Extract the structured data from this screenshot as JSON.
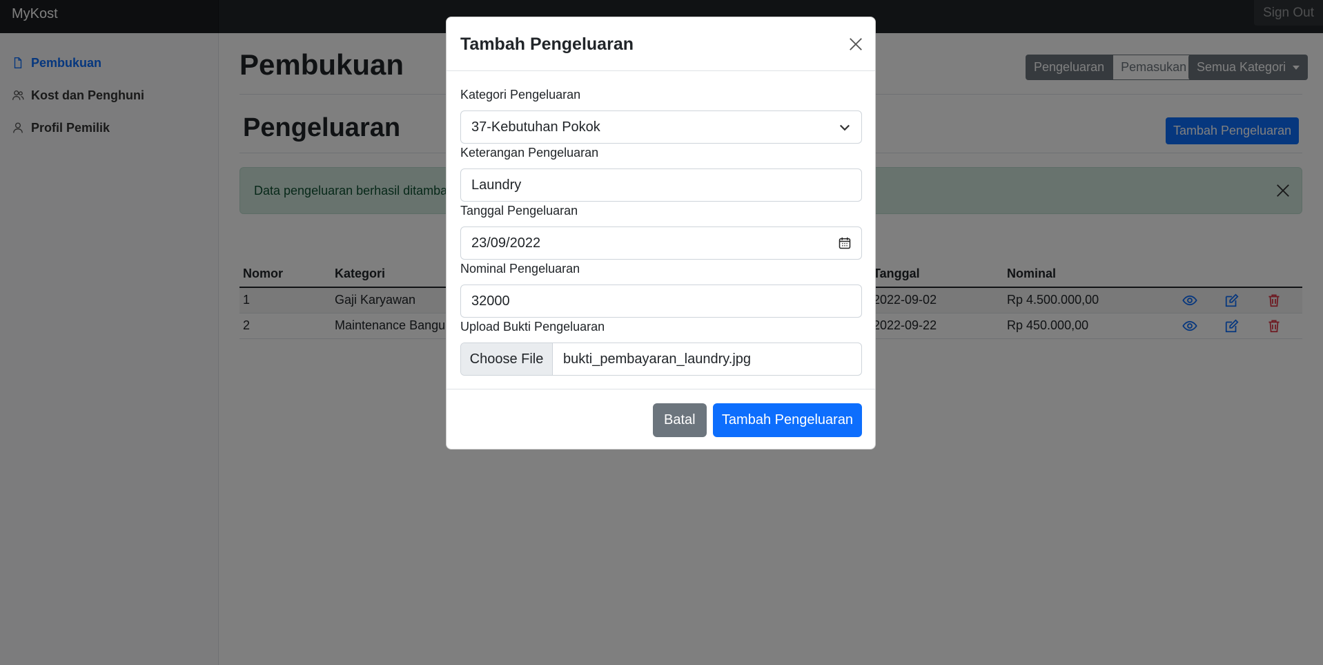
{
  "navbar": {
    "brand": "MyKost",
    "signout": "Sign Out"
  },
  "sidebar": {
    "items": [
      {
        "label": "Pembukuan",
        "icon": "file-icon",
        "active": true
      },
      {
        "label": "Kost dan Penghuni",
        "icon": "people-icon",
        "active": false
      },
      {
        "label": "Profil Pemilik",
        "icon": "person-icon",
        "active": false
      }
    ]
  },
  "main": {
    "title": "Pembukuan",
    "toggle": {
      "pengeluaran": "Pengeluaran",
      "pemasukan": "Pemasukan"
    },
    "category_dropdown": "Semua Kategori",
    "section_title": "Pengeluaran",
    "add_button": "Tambah Pengeluaran",
    "alert": "Data pengeluaran berhasil ditambah",
    "table": {
      "headers": [
        "Nomor",
        "Kategori",
        "Tanggal",
        "Nominal"
      ],
      "rows": [
        {
          "nomor": "1",
          "kategori": "Gaji Karyawan",
          "tanggal": "2022-09-02",
          "nominal": "Rp 4.500.000,00"
        },
        {
          "nomor": "2",
          "kategori": "Maintenance Bangun",
          "tanggal": "2022-09-22",
          "nominal": "Rp 450.000,00"
        }
      ]
    }
  },
  "modal": {
    "title": "Tambah Pengeluaran",
    "fields": {
      "kategori_label": "Kategori Pengeluaran",
      "kategori_value": "37-Kebutuhan Pokok",
      "keterangan_label": "Keterangan Pengeluaran",
      "keterangan_value": "Laundry",
      "tanggal_label": "Tanggal Pengeluaran",
      "tanggal_value": "23/09/2022",
      "nominal_label": "Nominal Pengeluaran",
      "nominal_value": "32000",
      "upload_label": "Upload Bukti Pengeluaran",
      "upload_button": "Choose File",
      "upload_filename": "bukti_pembayaran_laundry.jpg"
    },
    "cancel": "Batal",
    "submit": "Tambah Pengeluaran"
  },
  "colors": {
    "primary": "#0d6efd",
    "secondary": "#6c757d",
    "danger": "#dc3545",
    "success_bg": "#d1e7dd",
    "navbar": "#212529"
  }
}
